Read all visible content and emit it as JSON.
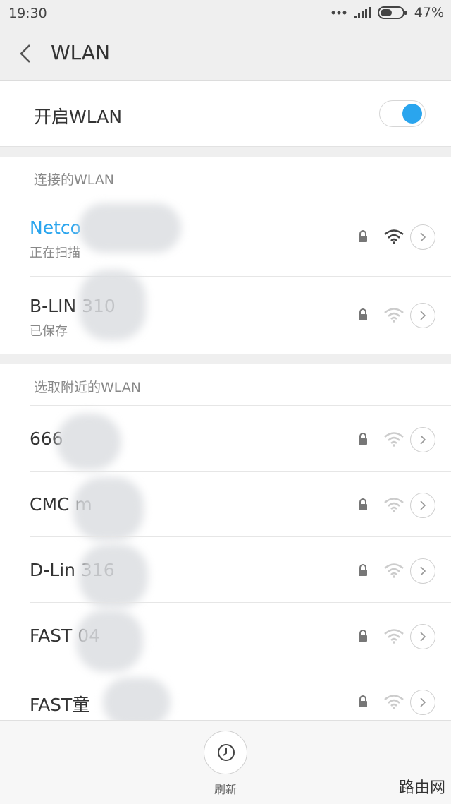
{
  "status_bar": {
    "time": "19:30",
    "battery_percent": "47%"
  },
  "header": {
    "title": "WLAN"
  },
  "wlan_toggle": {
    "label": "开启WLAN",
    "on": true
  },
  "sections": {
    "connected": {
      "header": "连接的WLAN",
      "networks": [
        {
          "name": "Netco",
          "status": "正在扫描",
          "secured": true,
          "signal": "strong",
          "active": true
        },
        {
          "name": "B-LIN          310",
          "status": "已保存",
          "secured": true,
          "signal": "weak",
          "active": false
        }
      ]
    },
    "nearby": {
      "header": "选取附近的WLAN",
      "networks": [
        {
          "name": "666",
          "secured": true,
          "signal": "weak"
        },
        {
          "name": "CMC         m",
          "secured": true,
          "signal": "weak"
        },
        {
          "name": "D-Lin          316",
          "secured": true,
          "signal": "weak"
        },
        {
          "name": "FAST           04",
          "secured": true,
          "signal": "weak"
        },
        {
          "name": "FAST童",
          "secured": true,
          "signal": "weak"
        }
      ]
    }
  },
  "bottom_bar": {
    "refresh_label": "刷新"
  },
  "watermark": "路由网",
  "colors": {
    "accent": "#2aa5ee",
    "background": "#efefef"
  }
}
